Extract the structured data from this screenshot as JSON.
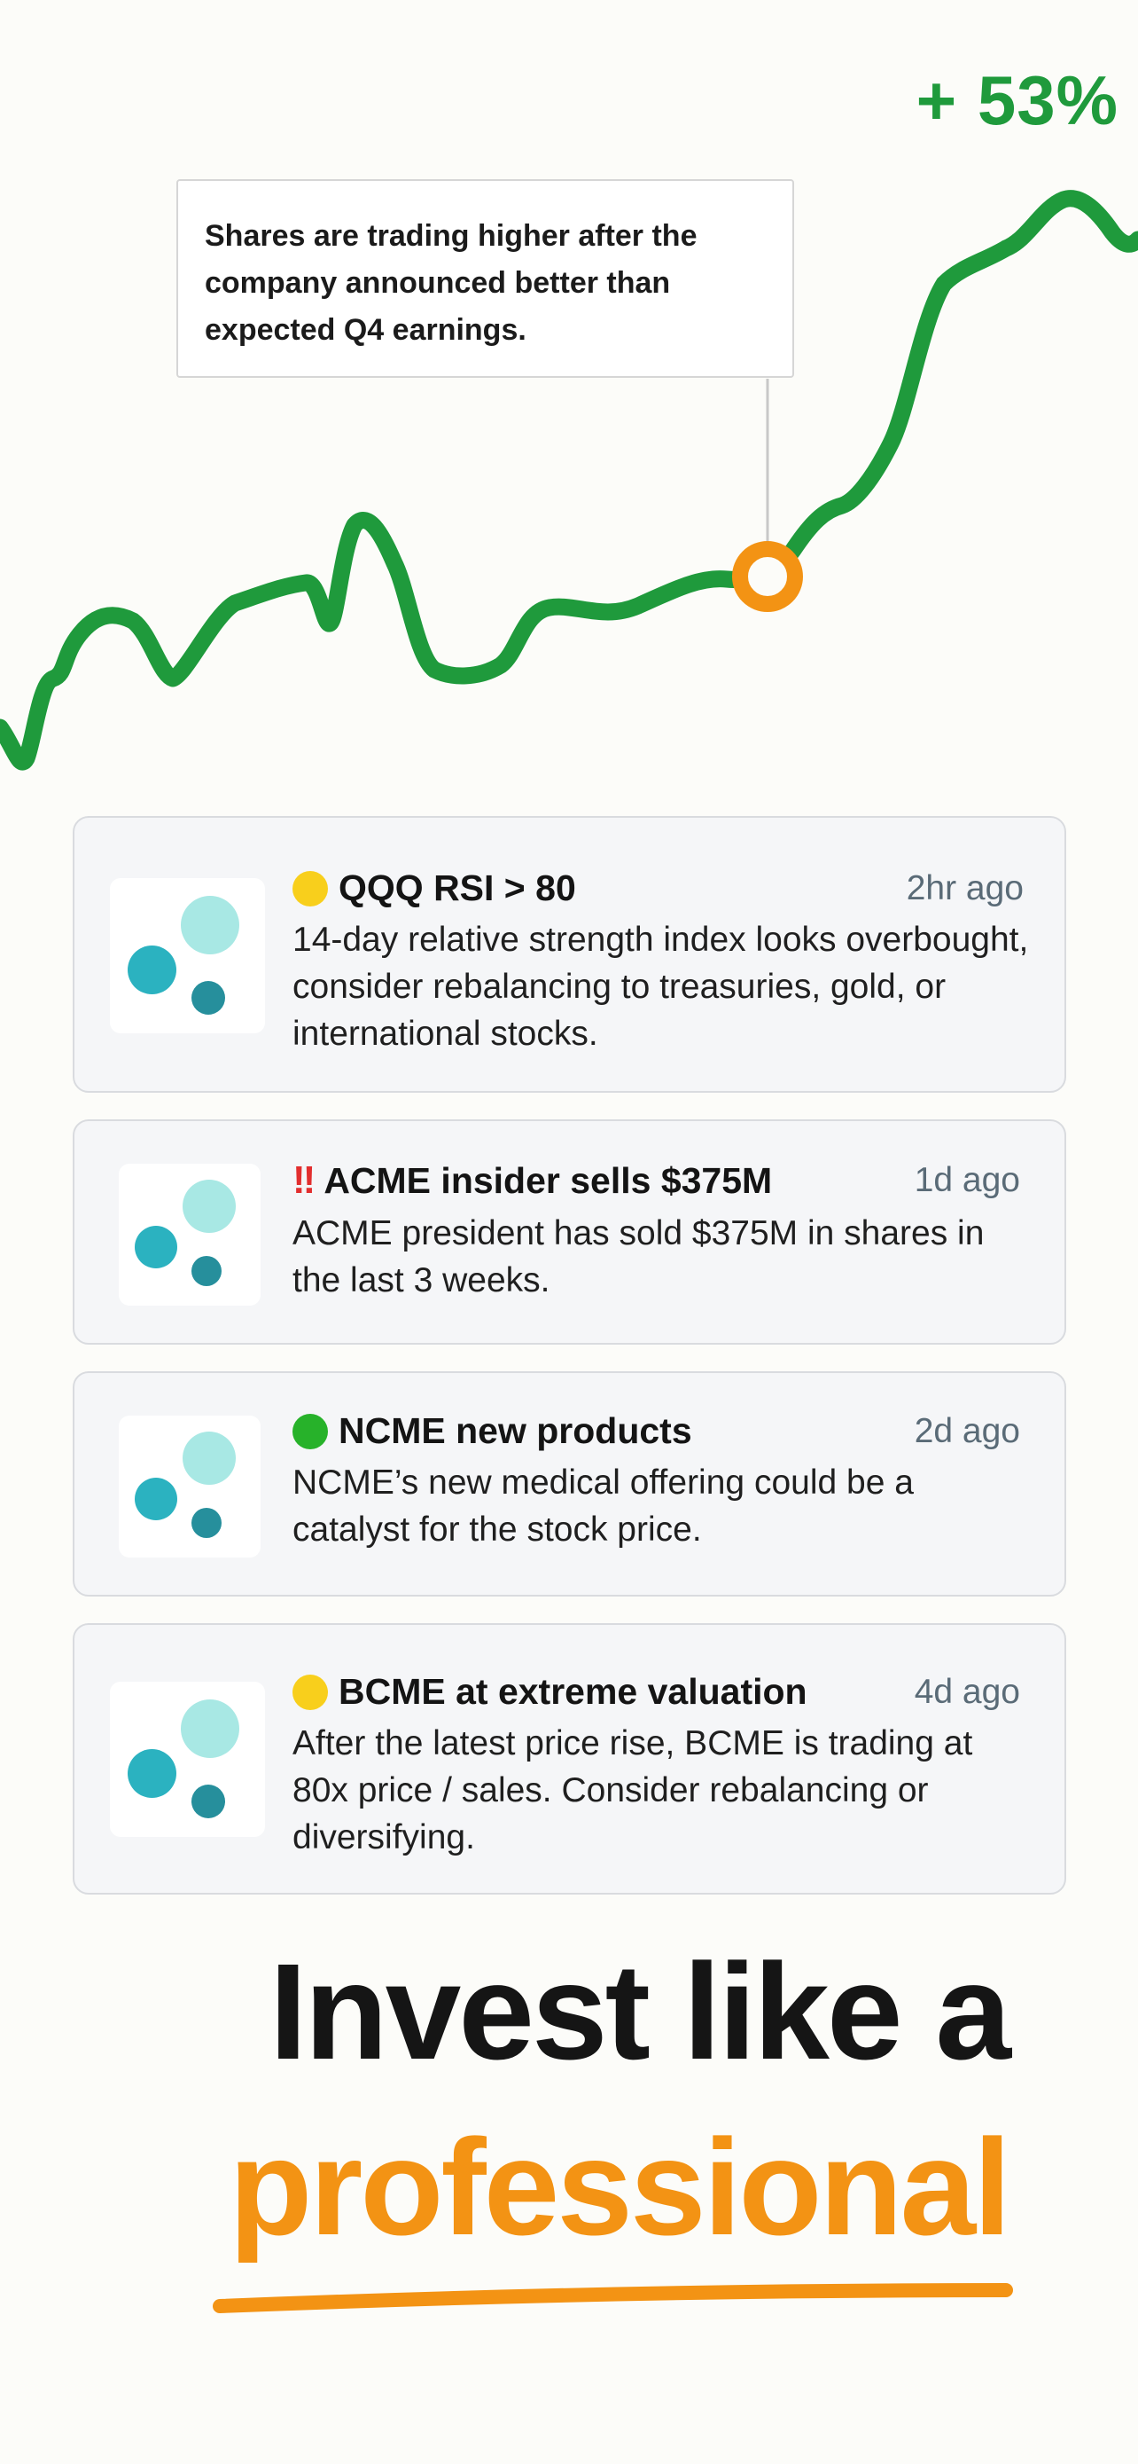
{
  "chart": {
    "gain_label": "+ 53%",
    "callout": "Shares are trading higher after the company announced better than expected Q4 earnings.",
    "line_color": "#1f9a3c",
    "marker_color": "#f39314"
  },
  "alerts": [
    {
      "indicator": "yellow-circle-emoji",
      "indicator_color": "#f8cf1c",
      "title": "QQQ RSI > 80",
      "time": "2hr ago",
      "description": "14-day relative strength index looks overbought, consider rebalancing to treasuries, gold, or international stocks."
    },
    {
      "indicator": "double-exclamation-emoji",
      "indicator_text": "!!",
      "title": "ACME insider sells $375M",
      "time": "1d ago",
      "description": "ACME president has sold $375M in shares in the last 3 weeks."
    },
    {
      "indicator": "green-circle-emoji",
      "indicator_color": "#27b22a",
      "title": "NCME new products",
      "time": "2d ago",
      "description": "NCME’s new medical offering could be a catalyst for the stock price."
    },
    {
      "indicator": "yellow-circle-emoji",
      "indicator_color": "#f8cf1c",
      "title": "BCME at extreme valuation",
      "time": "4d ago",
      "description": "After the latest price rise, BCME is trading at 80x price / sales. Consider rebalancing or diversifying."
    }
  ],
  "logo_colors": {
    "light": "#a8e8e4",
    "mid": "#2bb2c0",
    "dark": "#268f9c"
  },
  "headline": {
    "line1": "Invest like a",
    "line2": "professional",
    "accent_color": "#f39314"
  }
}
